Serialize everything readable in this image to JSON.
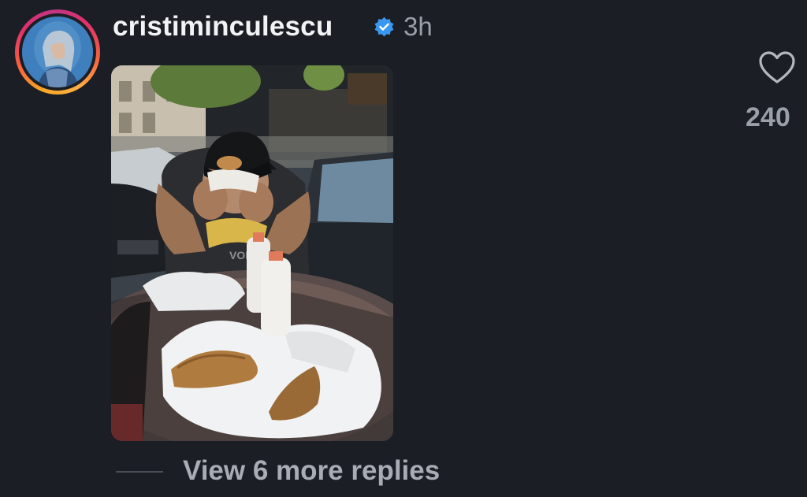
{
  "comment": {
    "username": "cristiminculescu",
    "verified_icon": "verified-badge-icon",
    "time_ago": "3h",
    "like_icon": "heart-outline-icon",
    "like_count": "240",
    "view_more_replies": "View 6 more replies"
  },
  "colors": {
    "background": "#1b1e24",
    "username": "#f2f3f5",
    "secondary_text": "#9aa0a8",
    "verified_blue": "#3897f0"
  }
}
